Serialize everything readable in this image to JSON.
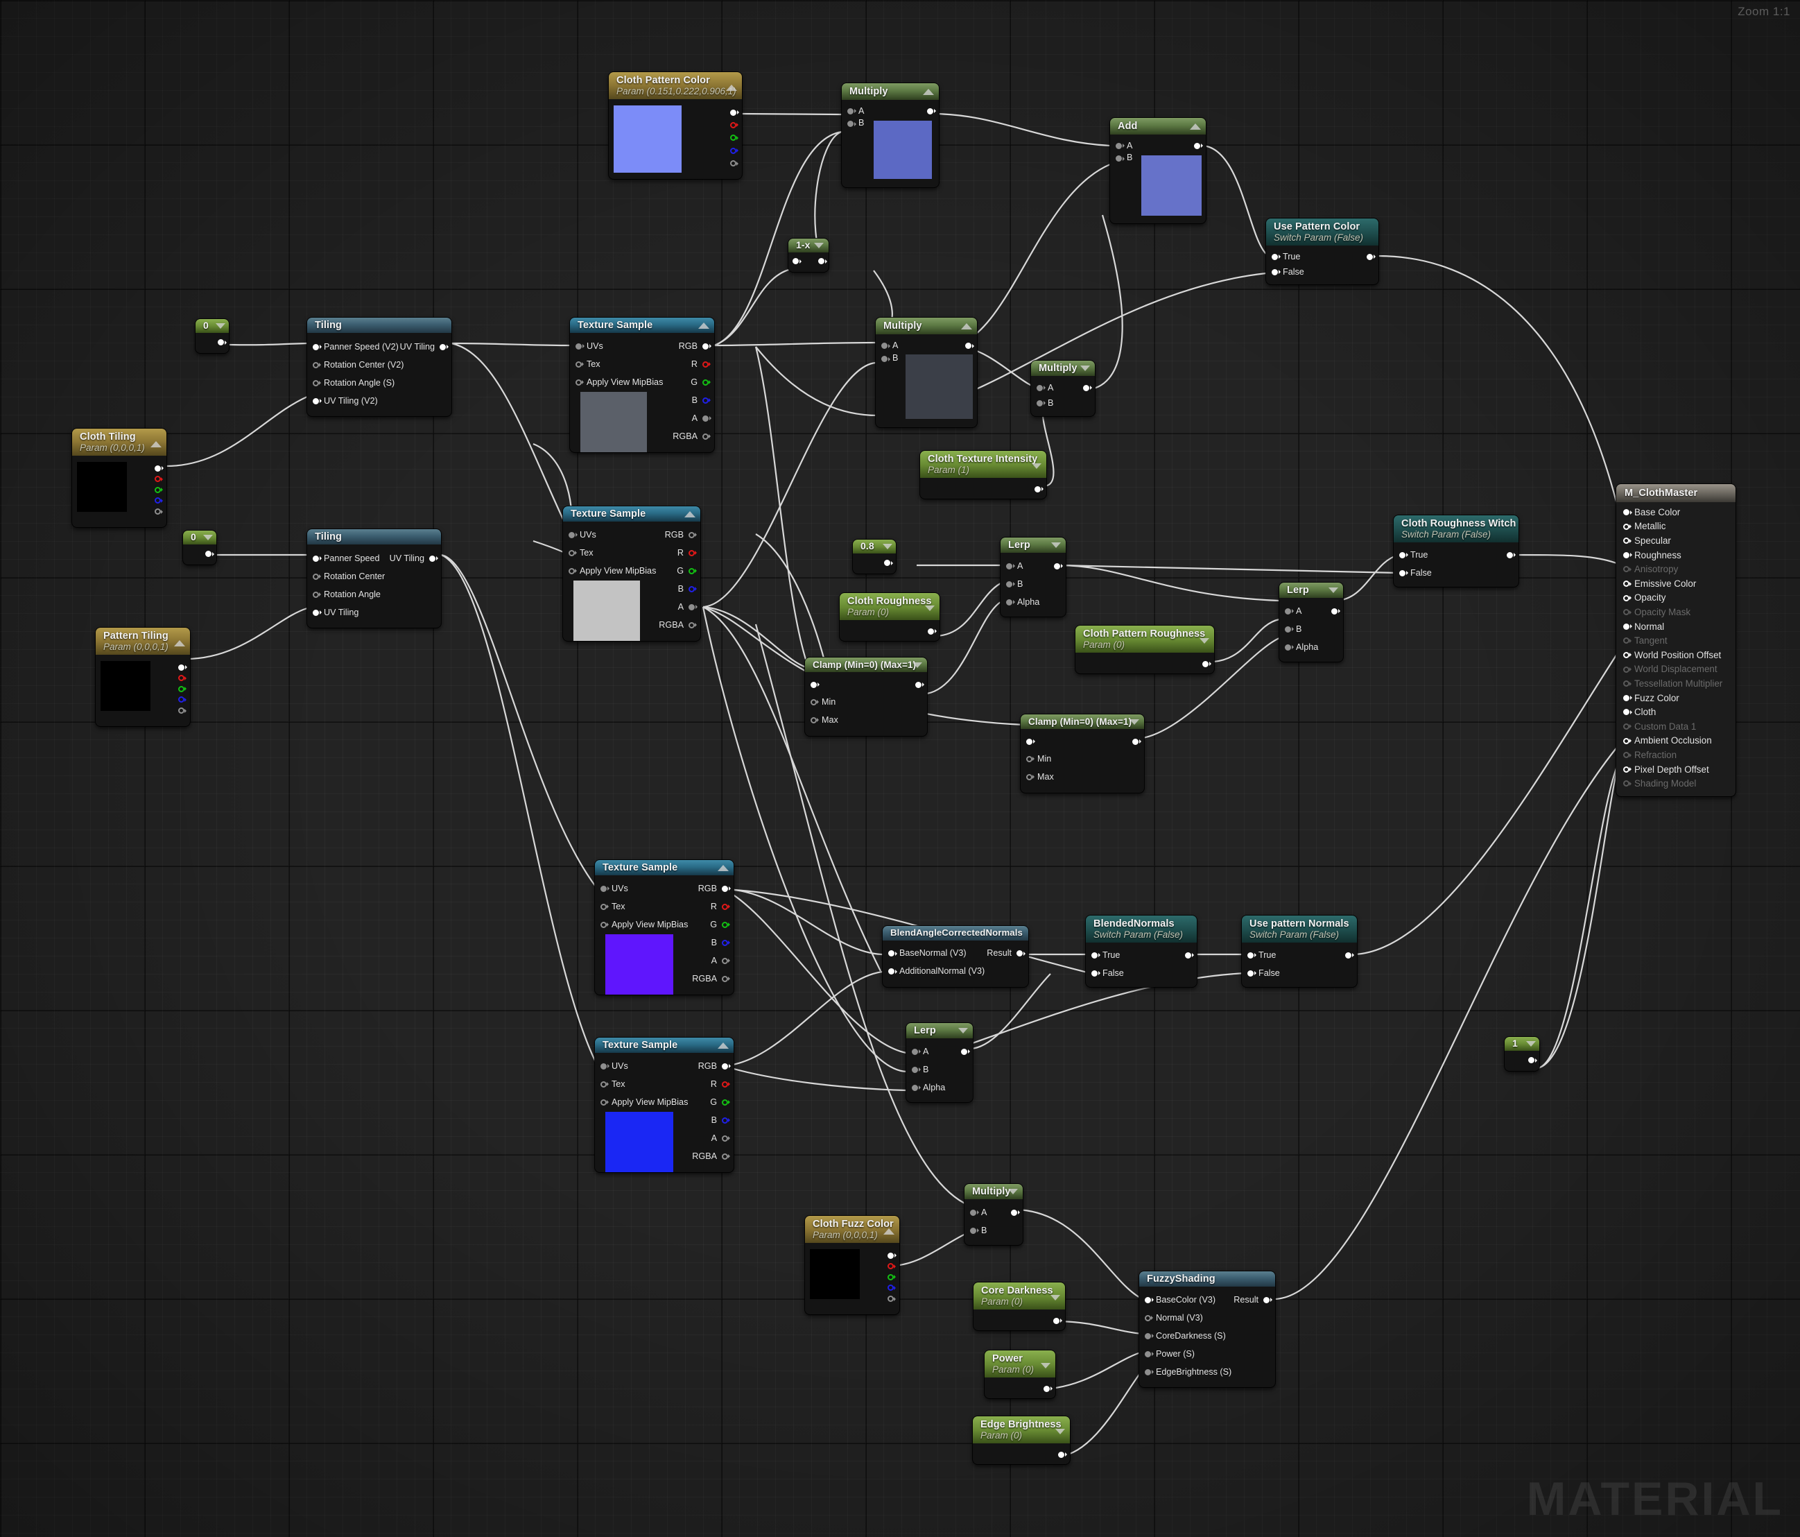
{
  "viewport": {
    "zoom_label": "Zoom 1:1",
    "watermark": "MATERIAL",
    "background_color": "#232323"
  },
  "nodes": {
    "cloth_pattern_color": {
      "title": "Cloth Pattern Color",
      "subtitle": "Param (0.151,0.222,0.906,1)",
      "swatch_color": "#7c8cf8",
      "outputs": [
        "",
        "",
        "",
        "",
        ""
      ]
    },
    "multiply_top": {
      "title": "Multiply",
      "in_a": "A",
      "in_b": "B",
      "swatch_color": "#5c69c4"
    },
    "add_top": {
      "title": "Add",
      "in_a": "A",
      "in_b": "B",
      "swatch_color": "#6672c9"
    },
    "use_pattern_color": {
      "title": "Use Pattern Color",
      "subtitle": "Switch Param (False)",
      "in_true": "True",
      "in_false": "False"
    },
    "one_minus_x": {
      "title": "1-x"
    },
    "const_zero_a": {
      "title": "0"
    },
    "const_zero_b": {
      "title": "0"
    },
    "const_08": {
      "title": "0.8"
    },
    "const_one": {
      "title": "1"
    },
    "tiling_top": {
      "title": "Tiling",
      "inputs": [
        "Panner Speed (V2)",
        "Rotation Center (V2)",
        "Rotation Angle (S)",
        "UV Tiling (V2)"
      ],
      "output": "UV Tiling"
    },
    "tiling_bottom": {
      "title": "Tiling",
      "inputs": [
        "Panner Speed",
        "Rotation Center",
        "Rotation Angle",
        "UV Tiling"
      ],
      "output": "UV Tiling"
    },
    "cloth_tiling": {
      "title": "Cloth Tiling",
      "subtitle": "Param (0,0,0,1)",
      "swatch_color": "#000000"
    },
    "pattern_tiling": {
      "title": "Pattern Tiling",
      "subtitle": "Param (0,0,0,1)",
      "swatch_color": "#000000"
    },
    "texture_sample_1": {
      "title": "Texture Sample",
      "inputs": [
        "UVs",
        "Tex",
        "Apply View MipBias"
      ],
      "outputs": [
        "RGB",
        "R",
        "G",
        "B",
        "A",
        "RGBA"
      ],
      "swatch_color": "#5b6069"
    },
    "texture_sample_2": {
      "title": "Texture Sample",
      "inputs": [
        "UVs",
        "Tex",
        "Apply View MipBias"
      ],
      "outputs": [
        "RGB",
        "R",
        "G",
        "B",
        "A",
        "RGBA"
      ],
      "swatch_color": "#c3c3c3"
    },
    "texture_sample_3": {
      "title": "Texture Sample",
      "inputs": [
        "UVs",
        "Tex",
        "Apply View MipBias"
      ],
      "outputs": [
        "RGB",
        "R",
        "G",
        "B",
        "A",
        "RGBA"
      ],
      "swatch_color": "#5f16fd"
    },
    "texture_sample_4": {
      "title": "Texture Sample",
      "inputs": [
        "UVs",
        "Tex",
        "Apply View MipBias"
      ],
      "outputs": [
        "RGB",
        "R",
        "G",
        "B",
        "A",
        "RGBA"
      ],
      "swatch_color": "#1a27f4"
    },
    "multiply_mid": {
      "title": "Multiply",
      "in_a": "A",
      "in_b": "B",
      "swatch_color": "#3b3f48"
    },
    "multiply_small": {
      "title": "Multiply",
      "in_a": "A",
      "in_b": "B"
    },
    "cloth_texture_intensity": {
      "title": "Cloth Texture Intensity",
      "subtitle": "Param (1)"
    },
    "cloth_roughness": {
      "title": "Cloth Roughness",
      "subtitle": "Param (0)"
    },
    "cloth_pattern_roughness": {
      "title": "Cloth Pattern Roughness",
      "subtitle": "Param (0)"
    },
    "lerp_rough": {
      "title": "Lerp",
      "in_a": "A",
      "in_b": "B",
      "in_alpha": "Alpha"
    },
    "lerp_rough2": {
      "title": "Lerp",
      "in_a": "A",
      "in_b": "B",
      "in_alpha": "Alpha"
    },
    "lerp_normal": {
      "title": "Lerp",
      "in_a": "A",
      "in_b": "B",
      "in_alpha": "Alpha"
    },
    "clamp_1": {
      "title": "Clamp (Min=0) (Max=1)",
      "in_min": "Min",
      "in_max": "Max"
    },
    "clamp_2": {
      "title": "Clamp (Min=0) (Max=1)",
      "in_min": "Min",
      "in_max": "Max"
    },
    "cloth_roughness_witch": {
      "title": "Cloth Roughness Witch",
      "subtitle": "Switch Param (False)",
      "in_true": "True",
      "in_false": "False"
    },
    "blend_angle_corrected_normals": {
      "title": "BlendAngleCorrectedNormals",
      "inputs": [
        "BaseNormal (V3)",
        "AdditionalNormal (V3)"
      ],
      "output": "Result"
    },
    "blended_normals": {
      "title": "BlendedNormals",
      "subtitle": "Switch Param (False)",
      "in_true": "True",
      "in_false": "False"
    },
    "use_pattern_normals": {
      "title": "Use pattern Normals",
      "subtitle": "Switch Param (False)",
      "in_true": "True",
      "in_false": "False"
    },
    "multiply_fuzz": {
      "title": "Multiply",
      "in_a": "A",
      "in_b": "B"
    },
    "cloth_fuzz_color": {
      "title": "Cloth Fuzz Color",
      "subtitle": "Param (0,0,0,1)",
      "swatch_color": "#000000"
    },
    "core_darkness": {
      "title": "Core Darkness",
      "subtitle": "Param (0)"
    },
    "power": {
      "title": "Power",
      "subtitle": "Param (0)"
    },
    "edge_brightness": {
      "title": "Edge Brightness",
      "subtitle": "Param (0)"
    },
    "fuzzy_shading": {
      "title": "FuzzyShading",
      "inputs": [
        "BaseColor (V3)",
        "Normal (V3)",
        "CoreDarkness (S)",
        "Power (S)",
        "EdgeBrightness (S)"
      ],
      "output": "Result"
    },
    "material_output": {
      "title": "M_ClothMaster",
      "pins": [
        {
          "label": "Base Color",
          "connected": true,
          "enabled": true
        },
        {
          "label": "Metallic",
          "connected": false,
          "enabled": true
        },
        {
          "label": "Specular",
          "connected": false,
          "enabled": true
        },
        {
          "label": "Roughness",
          "connected": true,
          "enabled": true
        },
        {
          "label": "Anisotropy",
          "connected": false,
          "enabled": false
        },
        {
          "label": "Emissive Color",
          "connected": false,
          "enabled": true
        },
        {
          "label": "Opacity",
          "connected": false,
          "enabled": true
        },
        {
          "label": "Opacity Mask",
          "connected": false,
          "enabled": false
        },
        {
          "label": "Normal",
          "connected": true,
          "enabled": true
        },
        {
          "label": "Tangent",
          "connected": false,
          "enabled": false
        },
        {
          "label": "World Position Offset",
          "connected": false,
          "enabled": true
        },
        {
          "label": "World Displacement",
          "connected": false,
          "enabled": false
        },
        {
          "label": "Tessellation Multiplier",
          "connected": false,
          "enabled": false
        },
        {
          "label": "Fuzz Color",
          "connected": true,
          "enabled": true
        },
        {
          "label": "Cloth",
          "connected": true,
          "enabled": true
        },
        {
          "label": "Custom Data 1",
          "connected": false,
          "enabled": false
        },
        {
          "label": "Ambient Occlusion",
          "connected": false,
          "enabled": true
        },
        {
          "label": "Refraction",
          "connected": false,
          "enabled": false
        },
        {
          "label": "Pixel Depth Offset",
          "connected": false,
          "enabled": true
        },
        {
          "label": "Shading Model",
          "connected": false,
          "enabled": false
        }
      ]
    }
  }
}
